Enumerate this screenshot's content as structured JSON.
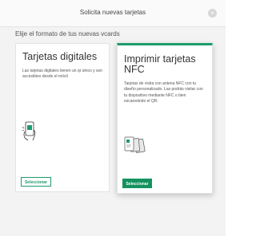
{
  "header": {
    "title": "Solicita nuevas tarjetas",
    "close_icon": "×"
  },
  "subtitle": "Elije el formato de tus nuevas vcards",
  "cards": [
    {
      "title": "Tarjetas digitales",
      "description": "Las tarjetas digitales tienen un qr único y son accesibles desde el móvil",
      "button_label": "Seleccionar",
      "icon": "phone-qr-icon"
    },
    {
      "title": "Imprimir tarjetas NFC",
      "description": "Tarjetas de visita con antena NFC con tu diseño personalizado. Las podrás visitar con tu dispositivo mediante NFC o bien escaneándo el QR.",
      "button_label": "Seleccionar",
      "icon": "nfc-cards-icon"
    }
  ],
  "colors": {
    "accent": "#1d9c6c",
    "accent_dark": "#14925f"
  }
}
